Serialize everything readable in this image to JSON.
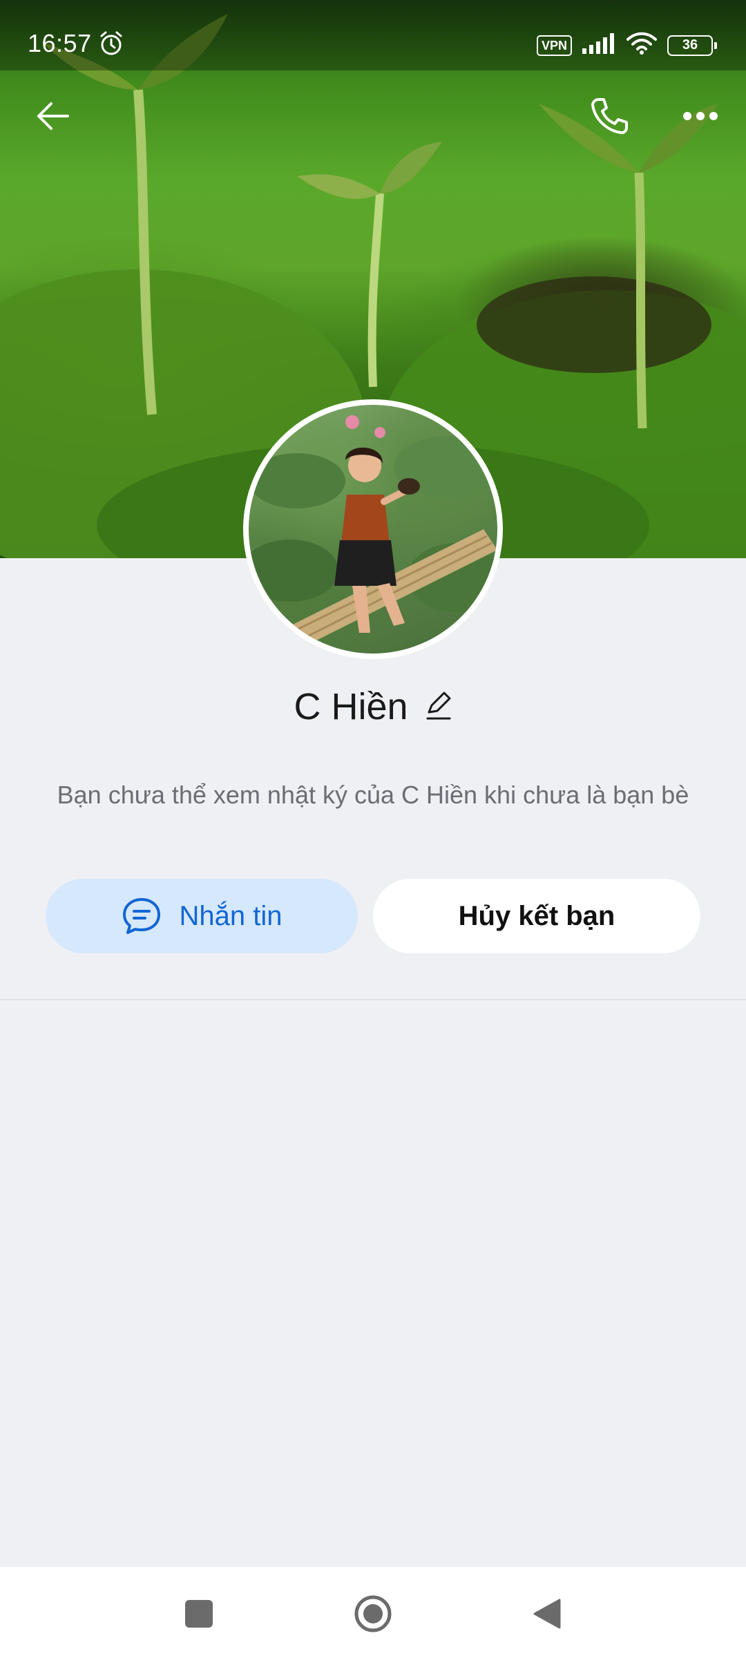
{
  "status_bar": {
    "time": "16:57",
    "vpn": "VPN",
    "battery": "36"
  },
  "header": {
    "back_icon": "arrow-left-icon",
    "call_icon": "phone-icon",
    "more_icon": "more-horizontal-icon"
  },
  "profile": {
    "name": "C Hiền",
    "edit_icon": "pencil-icon",
    "notice": "Bạn chưa thể xem nhật ký của C Hiền khi chưa là bạn bè"
  },
  "actions": {
    "message_label": "Nhắn tin",
    "message_icon": "chat-bubble-icon",
    "unfriend_label": "Hủy kết bạn"
  },
  "nav": {
    "recents_icon": "square-icon",
    "home_icon": "circle-icon",
    "back_icon": "triangle-back-icon"
  },
  "colors": {
    "accent": "#1166d4",
    "message_bg": "#d6e8fc",
    "page_bg": "#eff0f4"
  }
}
